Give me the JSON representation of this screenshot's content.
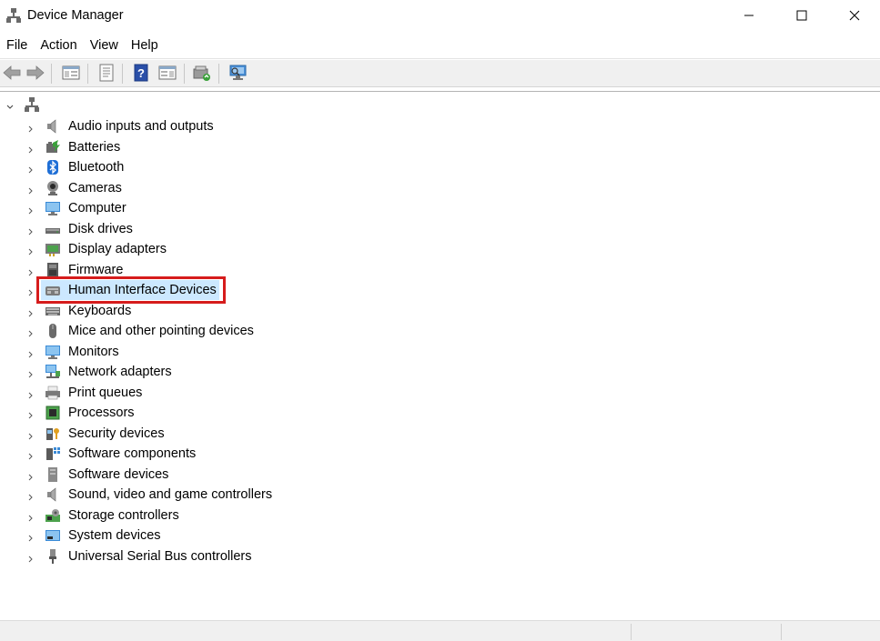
{
  "window": {
    "title": "Device Manager",
    "title_icon": "device-manager-icon",
    "controls": [
      "minimize-icon",
      "maximize-icon",
      "close-icon"
    ]
  },
  "menu": {
    "items": [
      "File",
      "Action",
      "View",
      "Help"
    ]
  },
  "toolbar": {
    "buttons": [
      "back-arrow-icon",
      "forward-arrow-icon",
      "show-hide-console-tree-icon",
      "properties-icon",
      "help-icon",
      "action-pane-icon",
      "update-driver-icon",
      "scan-hardware-icon"
    ]
  },
  "tree": {
    "root_icon": "computer-network-icon",
    "selected_label": "Human Interface Devices",
    "highlight_color": "#d61c1c",
    "selection_color": "#cce8ff",
    "nodes": [
      {
        "label": "Audio inputs and outputs",
        "icon": "speaker-icon"
      },
      {
        "label": "Batteries",
        "icon": "battery-icon"
      },
      {
        "label": "Bluetooth",
        "icon": "bluetooth-icon"
      },
      {
        "label": "Cameras",
        "icon": "camera-icon"
      },
      {
        "label": "Computer",
        "icon": "computer-icon"
      },
      {
        "label": "Disk drives",
        "icon": "disk-drive-icon"
      },
      {
        "label": "Display adapters",
        "icon": "display-adapter-icon"
      },
      {
        "label": "Firmware",
        "icon": "firmware-icon"
      },
      {
        "label": "Human Interface Devices",
        "icon": "hid-icon"
      },
      {
        "label": "Keyboards",
        "icon": "keyboard-icon"
      },
      {
        "label": "Mice and other pointing devices",
        "icon": "mouse-icon"
      },
      {
        "label": "Monitors",
        "icon": "monitor-icon"
      },
      {
        "label": "Network adapters",
        "icon": "network-adapter-icon"
      },
      {
        "label": "Print queues",
        "icon": "printer-icon"
      },
      {
        "label": "Processors",
        "icon": "processor-icon"
      },
      {
        "label": "Security devices",
        "icon": "security-device-icon"
      },
      {
        "label": "Software components",
        "icon": "software-component-icon"
      },
      {
        "label": "Software devices",
        "icon": "software-device-icon"
      },
      {
        "label": "Sound, video and game controllers",
        "icon": "sound-controller-icon"
      },
      {
        "label": "Storage controllers",
        "icon": "storage-controller-icon"
      },
      {
        "label": "System devices",
        "icon": "system-device-icon"
      },
      {
        "label": "Universal Serial Bus controllers",
        "icon": "usb-icon"
      }
    ]
  }
}
